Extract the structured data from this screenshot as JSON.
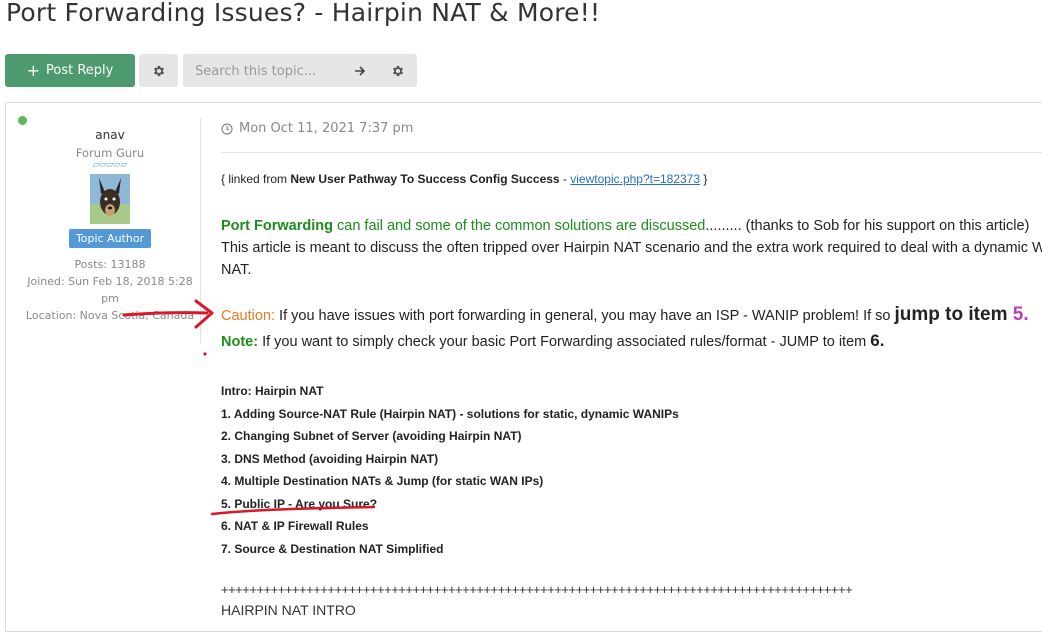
{
  "topic": {
    "title": "Port Forwarding Issues? - Hairpin NAT & More!!"
  },
  "toolbar": {
    "post_reply_label": "Post Reply",
    "search_placeholder": "Search this topic..."
  },
  "author": {
    "username": "anav",
    "rank": "Forum Guru",
    "rank_stars": "▱▱▱▱▱",
    "badge": "Topic Author",
    "posts": "Posts: 13188",
    "joined_line1": "Joined: Sun Feb 18, 2018 5:28",
    "joined_line2": "pm",
    "location": "Location: Nova Scotia, Canada",
    "online_color": "#5cb85c"
  },
  "post": {
    "date": "Mon Oct 11, 2021 7:37 pm",
    "linked_prefix": "{ linked from ",
    "linked_title": "New User Pathway To Success Config Success",
    "linked_sep": " - ",
    "linked_link": "viewtopic.php?t=182373",
    "linked_suffix": " }",
    "p1_green": "Port Forwarding",
    "p1_green2": " can fail and some of the common solutions are discussed",
    "p1_rest": "......... (thanks to Sob for his support on this article)",
    "p2": "This article is meant to discuss the often tripped over Hairpin NAT scenario and the extra work required to deal with a dynamic WAN",
    "p2b": "NAT.",
    "caution_label": "Caution:",
    "caution_text": " If you have issues with port forwarding in general, you may have an ISP - WANIP problem! If so ",
    "caution_jump": "jump to item ",
    "caution_num": "5.",
    "note_label": "Note:",
    "note_text": " If you want to simply check your basic Port Forwarding associated rules/format - JUMP to item ",
    "note_num": "6.",
    "toc": [
      "Intro: Hairpin NAT",
      "1. Adding Source-NAT Rule (Hairpin NAT) - solutions for static, dynamic WANIPs",
      "2. Changing Subnet of Server (avoiding Hairpin NAT)",
      "3. DNS Method (avoiding Hairpin NAT)",
      "4. Multiple Destination NATs & Jump (for static WAN IPs)",
      "5. Public IP - Are you Sure?",
      "6. NAT & IP Firewall Rules",
      "7. Source & Destination NAT Simplified"
    ],
    "separator": "+++++++++++++++++++++++++++++++++++++++++++++++++++++++++++++++++++++++++++++++++++++++++",
    "section_heading": "HAIRPIN NAT INTRO"
  },
  "colors": {
    "accent_green": "#4e9a6f",
    "text_green": "#1f8a1f",
    "caution_orange": "#e57b22",
    "item_purple": "#b53fb8",
    "annotation_red": "#d9182b",
    "badge_blue": "#5499d6",
    "link_blue": "#2a6fb8"
  }
}
